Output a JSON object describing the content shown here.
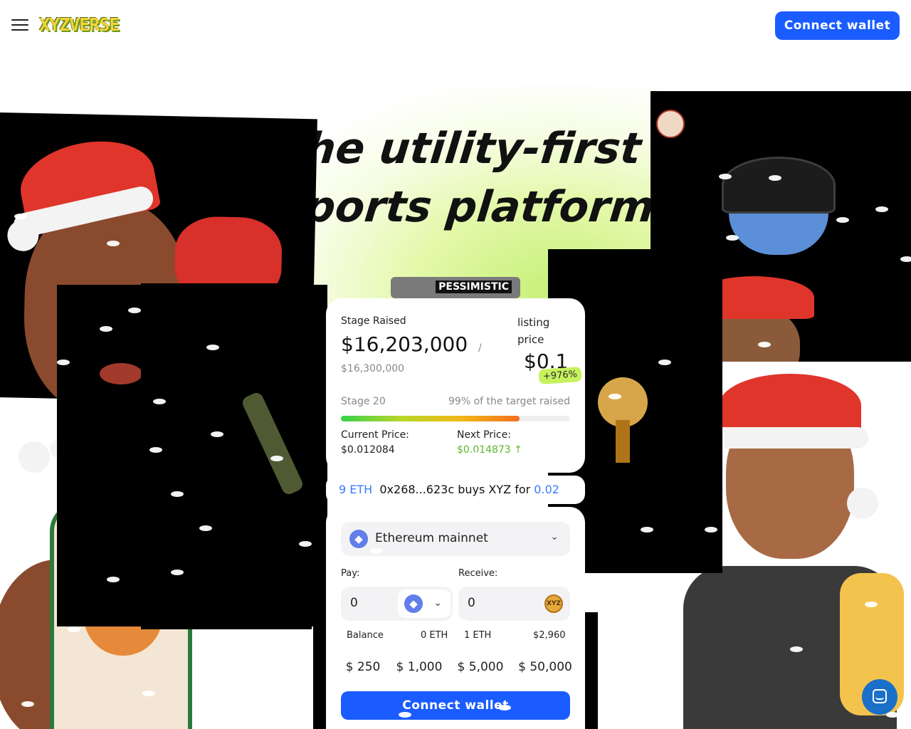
{
  "header": {
    "logo": "XYZVERSE",
    "connect_label": "Connect wallet"
  },
  "hero": {
    "headline_line1": "The utility-first",
    "headline_line2": "esports platform"
  },
  "tag": {
    "label": "PESSIMISTIC"
  },
  "stats": {
    "stage_raised_label": "Stage Raised",
    "raised_value": "$16,203,000",
    "slash": "/",
    "raised_target": "$16,300,000",
    "listing_label": "listing price",
    "listing_value": "$0.1",
    "listing_change": "+976%",
    "stage_label": "Stage 20",
    "target_text": "99% of the target raised",
    "progress_fraction": 0.78,
    "current_price_label": "Current Price:",
    "current_price": "$0.012084",
    "next_price_label": "Next Price:",
    "next_price": "$0.014873 ↑"
  },
  "ticker": {
    "amount_fragment": "9 ETH",
    "text": "0x268...623c buys XYZ for",
    "price_fragment": "0.02"
  },
  "swap": {
    "network": "Ethereum mainnet",
    "pay_label": "Pay:",
    "receive_label": "Receive:",
    "pay_value": "0",
    "receive_value": "0",
    "xyz_coin_text": "XYZ",
    "balance_label": "Balance",
    "balance_value": "0 ETH",
    "rate_left": "1 ETH",
    "rate_right": "$2,960",
    "amounts": [
      "$ 250",
      "$ 1,000",
      "$ 5,000",
      "$ 50,000"
    ],
    "connect_label": "Connect wallet"
  },
  "colors": {
    "accent": "#1a5cff",
    "price_up": "#5cb82a",
    "badge": "#c7f25e",
    "eth": "#627eea"
  },
  "icons": {
    "menu": "menu-icon",
    "eth": "ethereum-icon",
    "chevron": "chevron-down-icon",
    "chat": "chat-icon"
  }
}
